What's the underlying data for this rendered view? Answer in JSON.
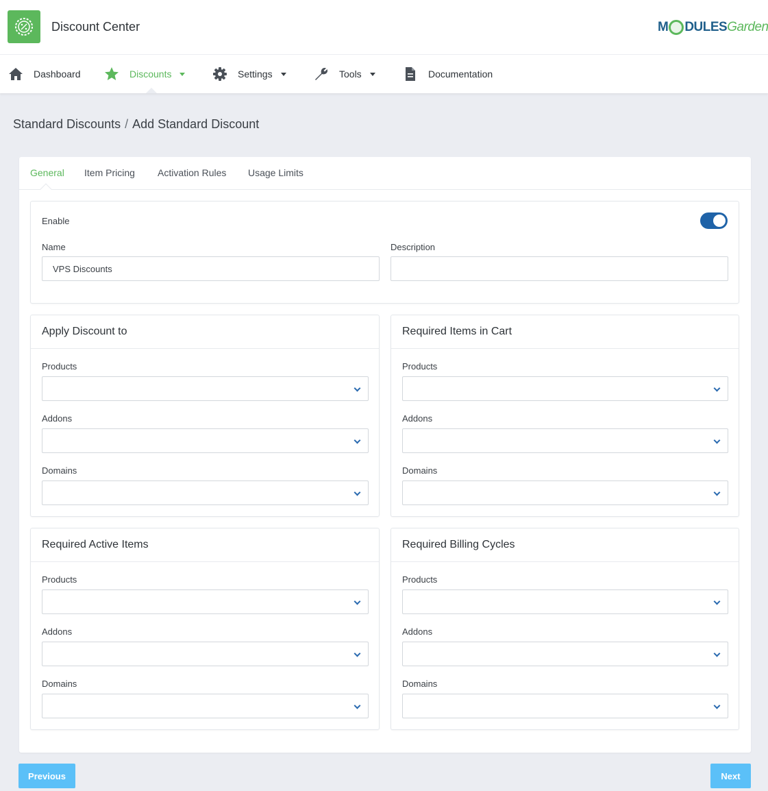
{
  "app": {
    "title": "Discount Center",
    "brand_bold_left": "M",
    "brand_bold_right": "DULES",
    "brand_light": "Garden"
  },
  "nav": {
    "dashboard": "Dashboard",
    "discounts": "Discounts",
    "settings": "Settings",
    "tools": "Tools",
    "documentation": "Documentation"
  },
  "breadcrumb": {
    "parent": "Standard Discounts",
    "separator": "/",
    "current": "Add Standard Discount"
  },
  "tabs": {
    "general": "General",
    "item_pricing": "Item Pricing",
    "activation_rules": "Activation Rules",
    "usage_limits": "Usage Limits"
  },
  "general": {
    "enable_label": "Enable",
    "enabled": true,
    "name_label": "Name",
    "name_value": "VPS Discounts",
    "description_label": "Description",
    "description_value": ""
  },
  "boxes": {
    "apply": {
      "title": "Apply Discount to",
      "products": "Products",
      "addons": "Addons",
      "domains": "Domains"
    },
    "required_cart": {
      "title": "Required Items in Cart",
      "products": "Products",
      "addons": "Addons",
      "domains": "Domains"
    },
    "required_active": {
      "title": "Required Active Items",
      "products": "Products",
      "addons": "Addons",
      "domains": "Domains"
    },
    "required_cycles": {
      "title": "Required Billing Cycles",
      "products": "Products",
      "addons": "Addons",
      "domains": "Domains"
    }
  },
  "buttons": {
    "previous": "Previous",
    "next": "Next"
  },
  "colors": {
    "accent_green": "#5cb85c",
    "toggle_blue": "#1f63a8",
    "button_blue": "#5bc0f8",
    "brand_blue": "#1f5f8b"
  }
}
